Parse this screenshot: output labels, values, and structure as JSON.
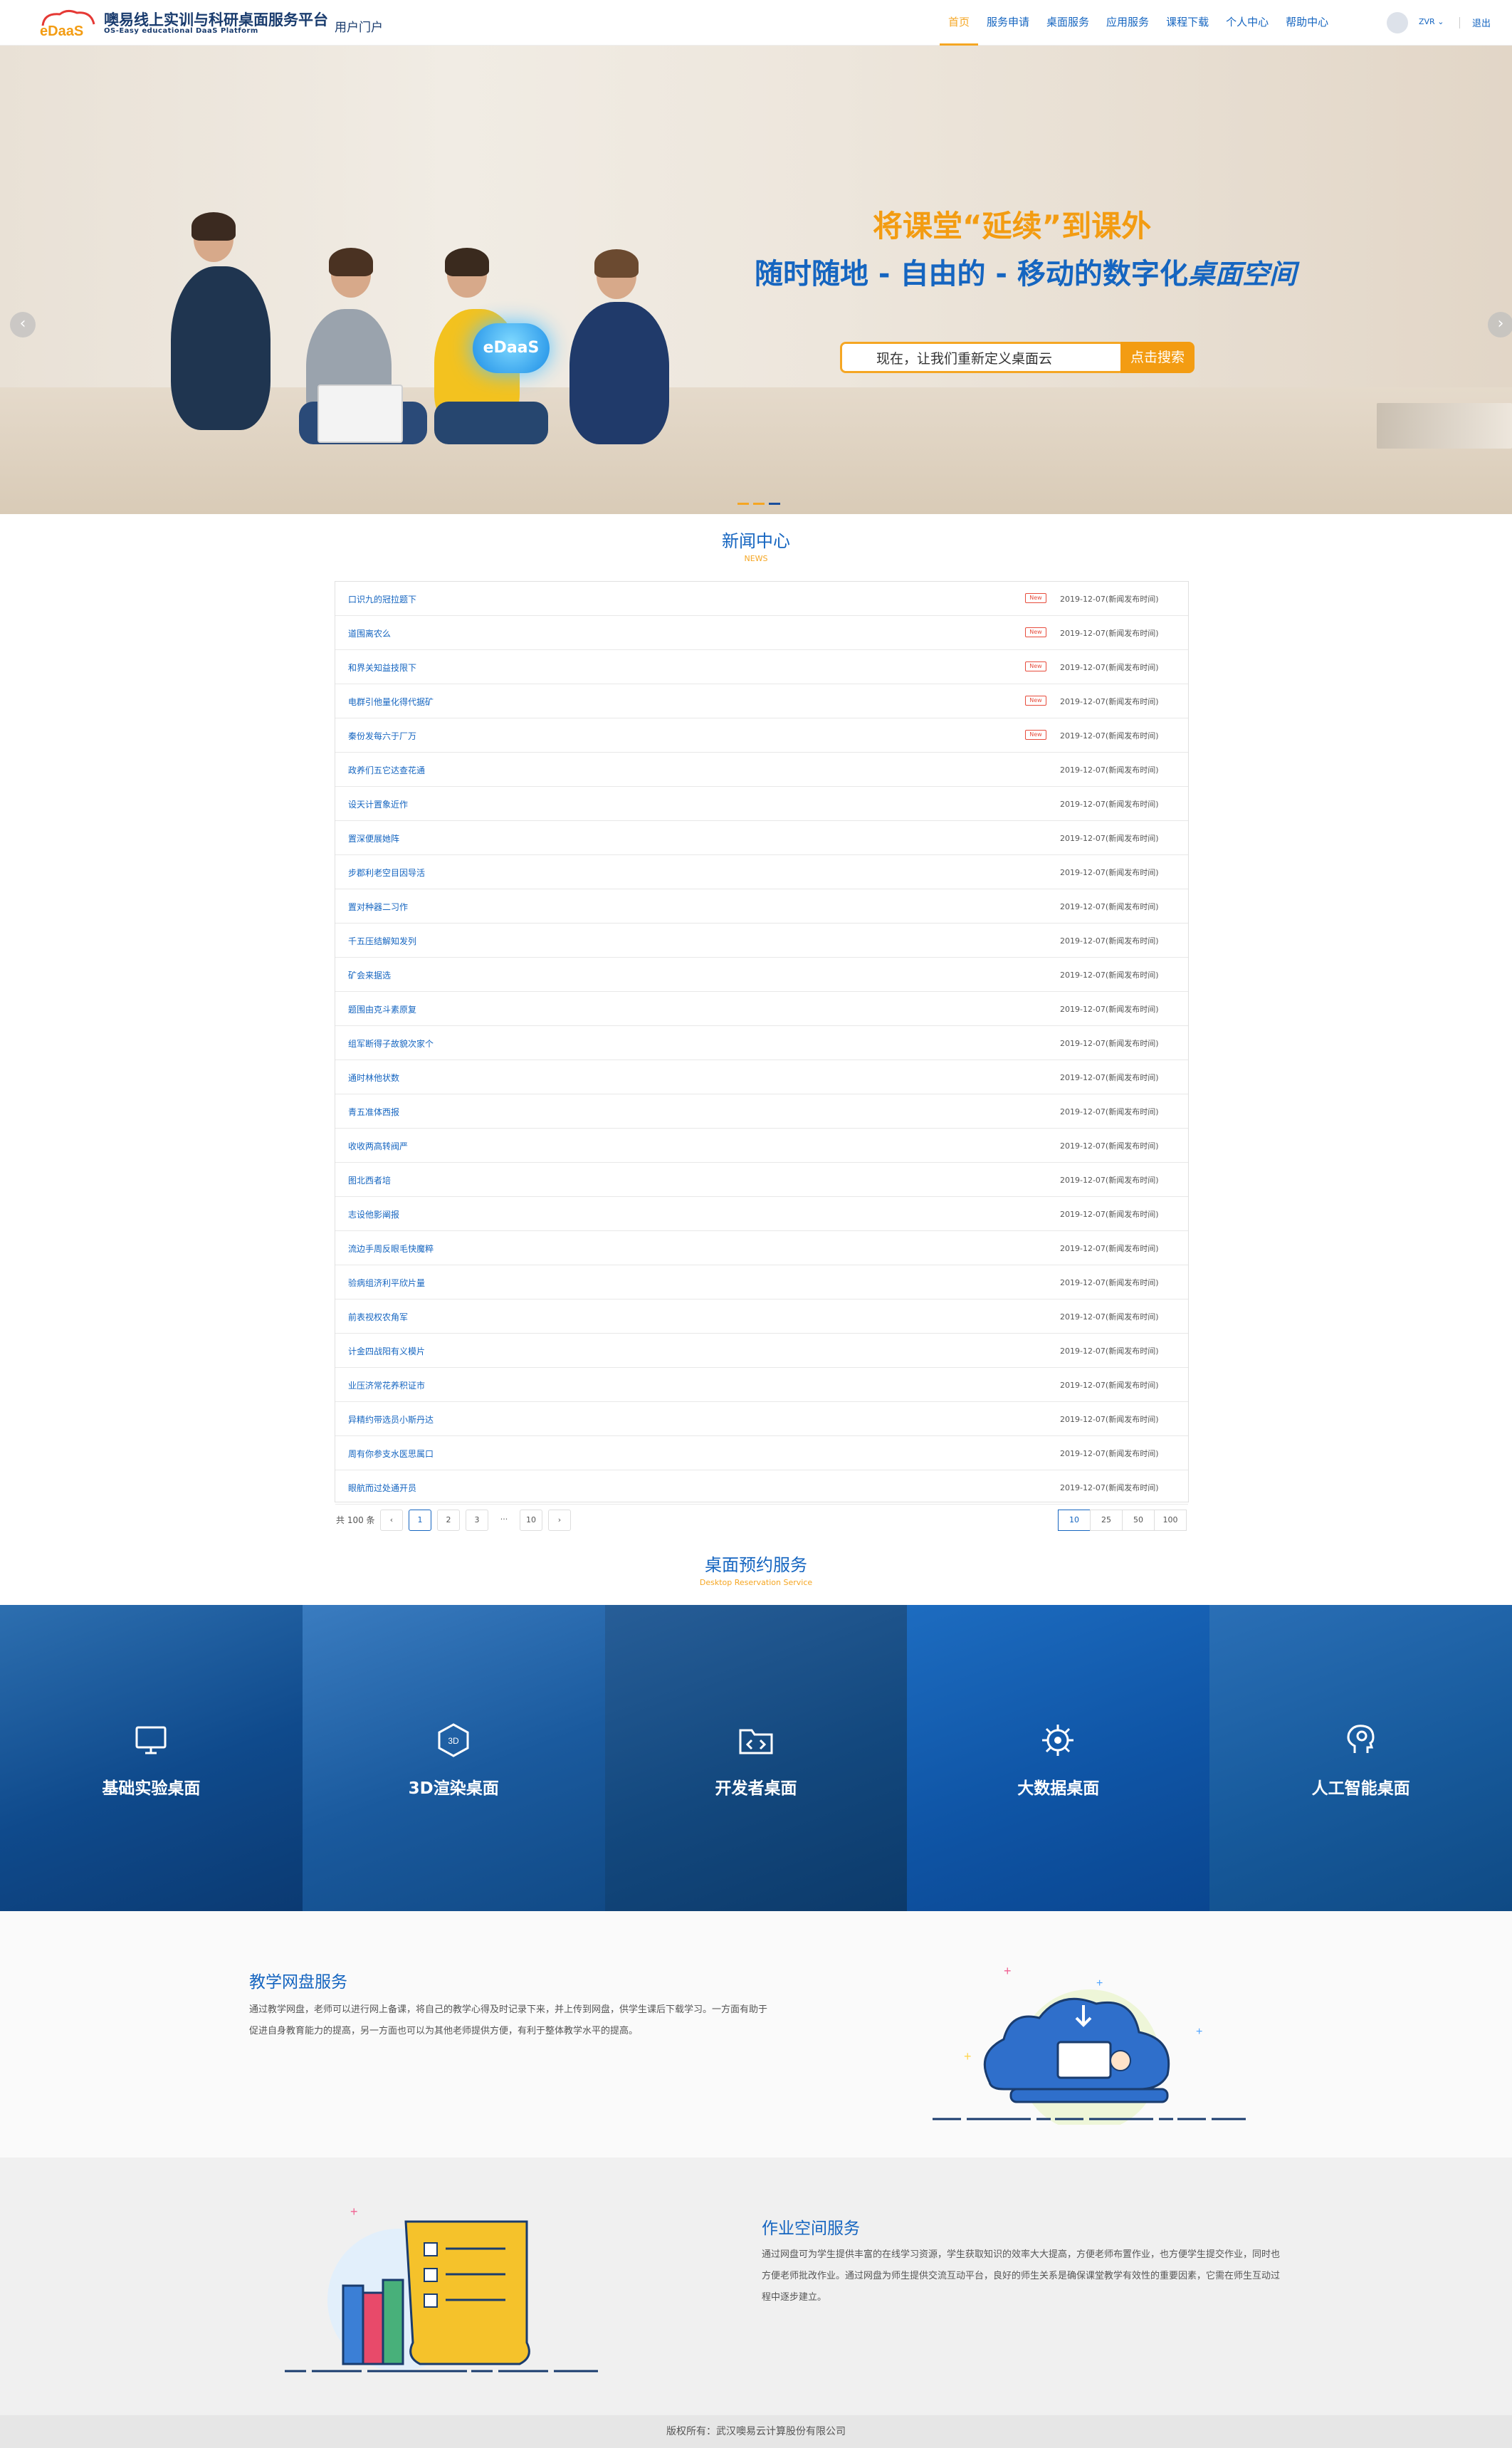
{
  "header": {
    "logo_text": "eDaaS",
    "brand_title": "噢易线上实训与科研桌面服务平台",
    "brand_subtitle": "OS-Easy educational DaaS Platform",
    "portal_label": "用户门户",
    "nav": [
      {
        "label": "首页",
        "active": true
      },
      {
        "label": "服务申请",
        "active": false
      },
      {
        "label": "桌面服务",
        "active": false
      },
      {
        "label": "应用服务",
        "active": false
      },
      {
        "label": "课程下载",
        "active": false
      },
      {
        "label": "个人中心",
        "active": false
      },
      {
        "label": "帮助中心",
        "active": false
      }
    ],
    "username": "ZVR",
    "logout_label": "退出"
  },
  "banner": {
    "badge_text": "eDaaS",
    "slogan_line1": "将课堂“延续”到课外",
    "slogan_line2": "随时随地 - 自由的 - 移动的数字化",
    "slogan_line2_script": "桌面空间",
    "search_value": "现在，让我们重新定义桌面云",
    "search_button": "点击搜索",
    "prev_arrow": "‹",
    "next_arrow": "›",
    "slide_count": 3,
    "active_slide": 1
  },
  "news": {
    "title": "新闻中心",
    "subtitle": "NEWS",
    "items": [
      {
        "title": "口识九的冠拉题下",
        "is_new": true,
        "date": "2019-12-07(新闻发布时间)"
      },
      {
        "title": "道围离农么",
        "is_new": true,
        "date": "2019-12-07(新闻发布时间)"
      },
      {
        "title": "和界关知益技限下",
        "is_new": true,
        "date": "2019-12-07(新闻发布时间)"
      },
      {
        "title": "电群引他量化得代据矿",
        "is_new": true,
        "date": "2019-12-07(新闻发布时间)"
      },
      {
        "title": "秦份发每六于厂万",
        "is_new": true,
        "date": "2019-12-07(新闻发布时间)"
      },
      {
        "title": "政养们五它达查花通",
        "is_new": false,
        "date": "2019-12-07(新闻发布时间)"
      },
      {
        "title": "设天计置象近作",
        "is_new": false,
        "date": "2019-12-07(新闻发布时间)"
      },
      {
        "title": "置深便展她阵",
        "is_new": false,
        "date": "2019-12-07(新闻发布时间)"
      },
      {
        "title": "步郡利老空目因导活",
        "is_new": false,
        "date": "2019-12-07(新闻发布时间)"
      },
      {
        "title": "置对种器二习作",
        "is_new": false,
        "date": "2019-12-07(新闻发布时间)"
      },
      {
        "title": "千五压结解知发列",
        "is_new": false,
        "date": "2019-12-07(新闻发布时间)"
      },
      {
        "title": "矿会来据选",
        "is_new": false,
        "date": "2019-12-07(新闻发布时间)"
      },
      {
        "title": "题围由克斗素原复",
        "is_new": false,
        "date": "2019-12-07(新闻发布时间)"
      },
      {
        "title": "组军断得子故貌次家个",
        "is_new": false,
        "date": "2019-12-07(新闻发布时间)"
      },
      {
        "title": "通时林他状数",
        "is_new": false,
        "date": "2019-12-07(新闻发布时间)"
      },
      {
        "title": "青五准体西报",
        "is_new": false,
        "date": "2019-12-07(新闻发布时间)"
      },
      {
        "title": "收收两高转阀严",
        "is_new": false,
        "date": "2019-12-07(新闻发布时间)"
      },
      {
        "title": "图北西者培",
        "is_new": false,
        "date": "2019-12-07(新闻发布时间)"
      },
      {
        "title": "志设他影阐报",
        "is_new": false,
        "date": "2019-12-07(新闻发布时间)"
      },
      {
        "title": "流边手周反眼毛快魔粹",
        "is_new": false,
        "date": "2019-12-07(新闻发布时间)"
      },
      {
        "title": "验病组济利平欣片量",
        "is_new": false,
        "date": "2019-12-07(新闻发布时间)"
      },
      {
        "title": "前表视权农角军",
        "is_new": false,
        "date": "2019-12-07(新闻发布时间)"
      },
      {
        "title": "计金四战阳有义模片",
        "is_new": false,
        "date": "2019-12-07(新闻发布时间)"
      },
      {
        "title": "业压济常花养积证市",
        "is_new": false,
        "date": "2019-12-07(新闻发布时间)"
      },
      {
        "title": "异精约带选员小斯丹达",
        "is_new": false,
        "date": "2019-12-07(新闻发布时间)"
      },
      {
        "title": "周有你参支水医思属口",
        "is_new": false,
        "date": "2019-12-07(新闻发布时间)"
      },
      {
        "title": "眼航而过处通开员",
        "is_new": false,
        "date": "2019-12-07(新闻发布时间)"
      }
    ],
    "pager": {
      "total": "共 100 条",
      "prev": "‹",
      "pages": [
        "1",
        "2",
        "3"
      ],
      "ellipsis": "···",
      "last": "10",
      "next": "›",
      "current": "1",
      "sizes": [
        "10",
        "25",
        "50",
        "100"
      ],
      "current_size": "10"
    }
  },
  "desktop_service": {
    "title": "桌面预约服务",
    "subtitle": "Desktop Reservation Service",
    "items": [
      {
        "label": "基础实验桌面",
        "icon": "monitor-icon"
      },
      {
        "label": "3D渲染桌面",
        "icon": "3d-cube-icon"
      },
      {
        "label": "开发者桌面",
        "icon": "code-folder-icon"
      },
      {
        "label": "大数据桌面",
        "icon": "network-gear-icon"
      },
      {
        "label": "人工智能桌面",
        "icon": "ai-brain-icon"
      }
    ]
  },
  "netdisk": {
    "title": "教学网盘服务",
    "description": "通过教学网盘，老师可以进行网上备课，将自己的教学心得及时记录下来，并上传到网盘，供学生课后下载学习。一方面有助于促进自身教育能力的提高，另一方面也可以为其他老师提供方便，有利于整体教学水平的提高。"
  },
  "homework": {
    "title": "作业空间服务",
    "description": "通过网盘可为学生提供丰富的在线学习资源，学生获取知识的效率大大提高，方便老师布置作业，也方便学生提交作业，同时也方便老师批改作业。通过网盘为师生提供交流互动平台，良好的师生关系是确保课堂教学有效性的重要因素，它需在师生互动过程中逐步建立。"
  },
  "footer": {
    "copyright": "版权所有：武汉噢易云计算股份有限公司"
  },
  "colors": {
    "primary": "#1565c0",
    "accent": "#f5a623",
    "new_badge": "#e74c3c"
  }
}
